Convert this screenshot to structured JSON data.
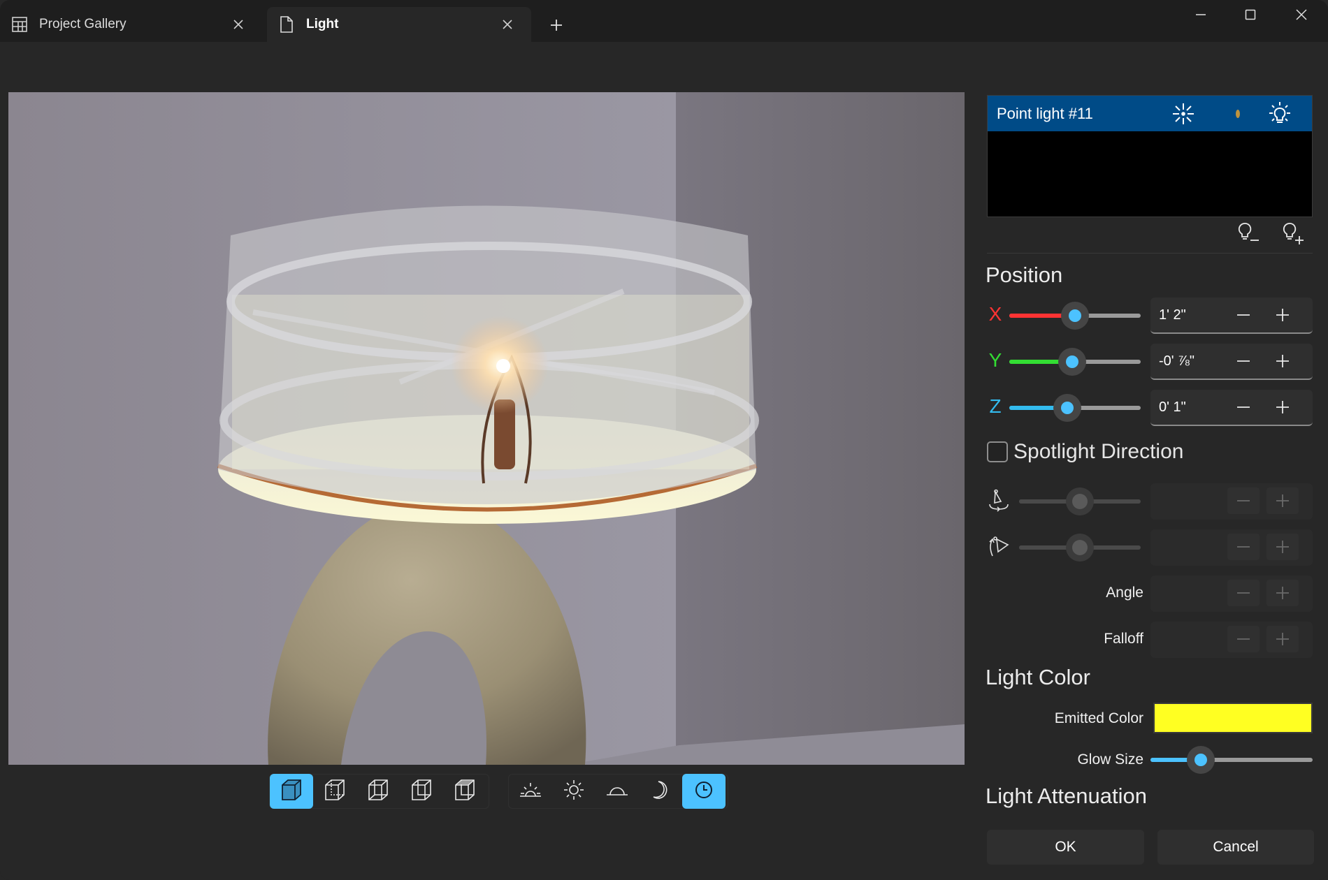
{
  "window": {
    "tabs": [
      {
        "label": "Project Gallery",
        "icon": "gallery-icon",
        "active": false
      },
      {
        "label": "Light",
        "icon": "document-icon",
        "active": true
      }
    ],
    "new_tab_symbol": "+",
    "controls": [
      "minimize",
      "maximize",
      "close"
    ]
  },
  "viewport": {
    "scene": "table lamp with drum shade and glowing point light",
    "toolbar": {
      "view_modes": [
        {
          "name": "view-solid-icon",
          "active": true
        },
        {
          "name": "view-wireframe-back-icon",
          "active": false
        },
        {
          "name": "view-wireframe-left-icon",
          "active": false
        },
        {
          "name": "view-wireframe-right-icon",
          "active": false
        },
        {
          "name": "view-wireframe-top-icon",
          "active": false
        }
      ],
      "lighting_modes": [
        {
          "name": "sunrise-icon",
          "active": false
        },
        {
          "name": "sun-icon",
          "active": false
        },
        {
          "name": "sunset-icon",
          "active": false
        },
        {
          "name": "moon-icon",
          "active": false
        },
        {
          "name": "clock-icon",
          "active": true
        }
      ]
    }
  },
  "panel": {
    "lights": [
      {
        "name": "Point light #11",
        "selected": true
      }
    ],
    "colors": {
      "selection": "#004b87",
      "accent": "#4cc2ff",
      "x_axis": "#ff3333",
      "y_axis": "#33dd33",
      "z_axis": "#33bbee",
      "emitted_color": "#ffff22"
    },
    "position": {
      "title": "Position",
      "axes": [
        {
          "label": "X",
          "value": "1' 2\"",
          "slider_fraction": 0.5
        },
        {
          "label": "Y",
          "value": "-0' ⅞\"",
          "slider_fraction": 0.48
        },
        {
          "label": "Z",
          "value": "0' 1\"",
          "slider_fraction": 0.44
        }
      ],
      "minus": "−",
      "plus": "+"
    },
    "spotlight": {
      "checkbox_label": "Spotlight Direction",
      "checked": false,
      "rotate_slider_fraction": 0.5,
      "tilt_slider_fraction": 0.5,
      "angle_label": "Angle",
      "falloff_label": "Falloff"
    },
    "light_color": {
      "title": "Light Color",
      "emitted_label": "Emitted Color",
      "glow_label": "Glow Size",
      "glow_fraction": 0.31
    },
    "attenuation": {
      "title": "Light Attenuation"
    },
    "buttons": {
      "ok": "OK",
      "cancel": "Cancel"
    }
  }
}
